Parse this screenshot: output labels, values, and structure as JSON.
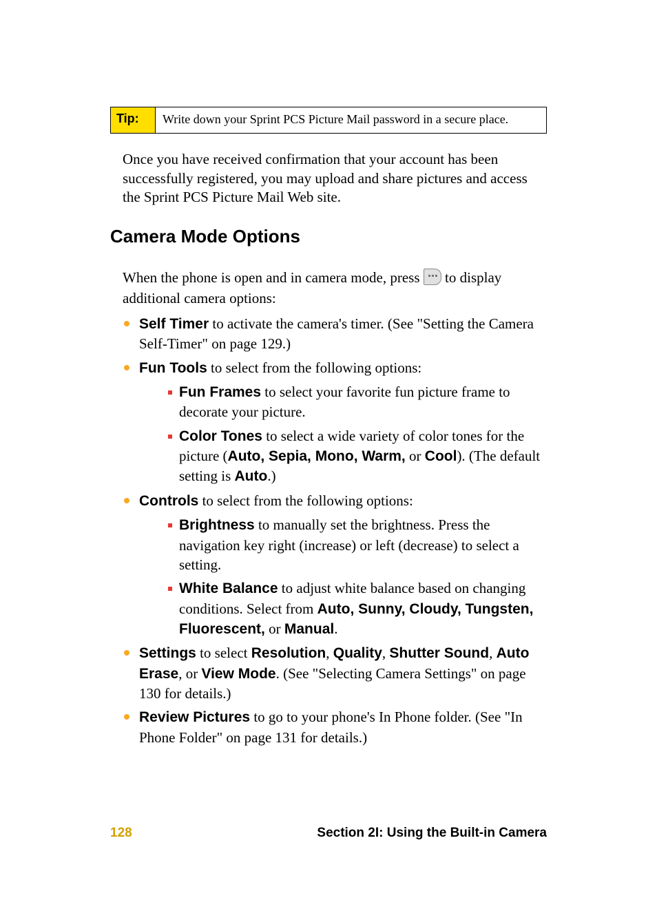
{
  "tip": {
    "label": "Tip:",
    "content": "Write down your Sprint PCS Picture Mail password in a secure place."
  },
  "para1": "Once you have received confirmation that your account has been successfully registered, you may upload and share pictures and access the Sprint PCS Picture Mail Web site.",
  "heading": "Camera Mode Options",
  "intro_pre": "When the phone is open and in camera mode, press ",
  "intro_post": " to display additional camera options:",
  "bullets": {
    "b1": {
      "label": "Self Timer",
      "text": " to activate the camera's timer. (See \"Setting the Camera Self-Timer\" on page 129.)"
    },
    "b2": {
      "label": "Fun Tools",
      "text": " to select from the following options:"
    },
    "b2s1": {
      "label": "Fun Frames",
      "text": " to select your favorite fun picture frame to decorate your picture."
    },
    "b2s2_pre": "Color Tones",
    "b2s2_mid1": " to select a wide variety of color tones for the picture (",
    "b2s2_bold1": "Auto, Sepia, Mono, Warm,",
    "b2s2_mid2": " or ",
    "b2s2_bold2": "Cool",
    "b2s2_mid3": "). (The default setting is ",
    "b2s2_bold3": "Auto",
    "b2s2_end": ".)",
    "b3": {
      "label": "Controls",
      "text": " to select from the following options:"
    },
    "b3s1": {
      "label": "Brightness",
      "text": " to manually set the brightness. Press the navigation key right (increase) or left (decrease) to select a setting."
    },
    "b3s2_pre": "White Balance",
    "b3s2_mid1": " to adjust white balance based on changing conditions. Select from ",
    "b3s2_bold1": "Auto, Sunny, Cloudy, Tungsten, Fluorescent,",
    "b3s2_mid2": " or ",
    "b3s2_bold2": "Manual",
    "b3s2_end": ".",
    "b4_pre": "Settings",
    "b4_mid1": " to select ",
    "b4_bold1": "Resolution",
    "b4_c1": ", ",
    "b4_bold2": "Quality",
    "b4_c2": ", ",
    "b4_bold3": "Shutter Sound",
    "b4_c3": ", ",
    "b4_bold4": "Auto Erase",
    "b4_c4": ", or ",
    "b4_bold5": "View Mode",
    "b4_end": ". (See \"Selecting Camera Settings\" on page 130 for details.)",
    "b5": {
      "label": "Review Pictures",
      "text": " to go to your phone's In Phone folder. (See \"In Phone Folder\" on page 131 for details.)"
    }
  },
  "footer": {
    "page": "128",
    "section": "Section 2I: Using the Built-in Camera"
  }
}
